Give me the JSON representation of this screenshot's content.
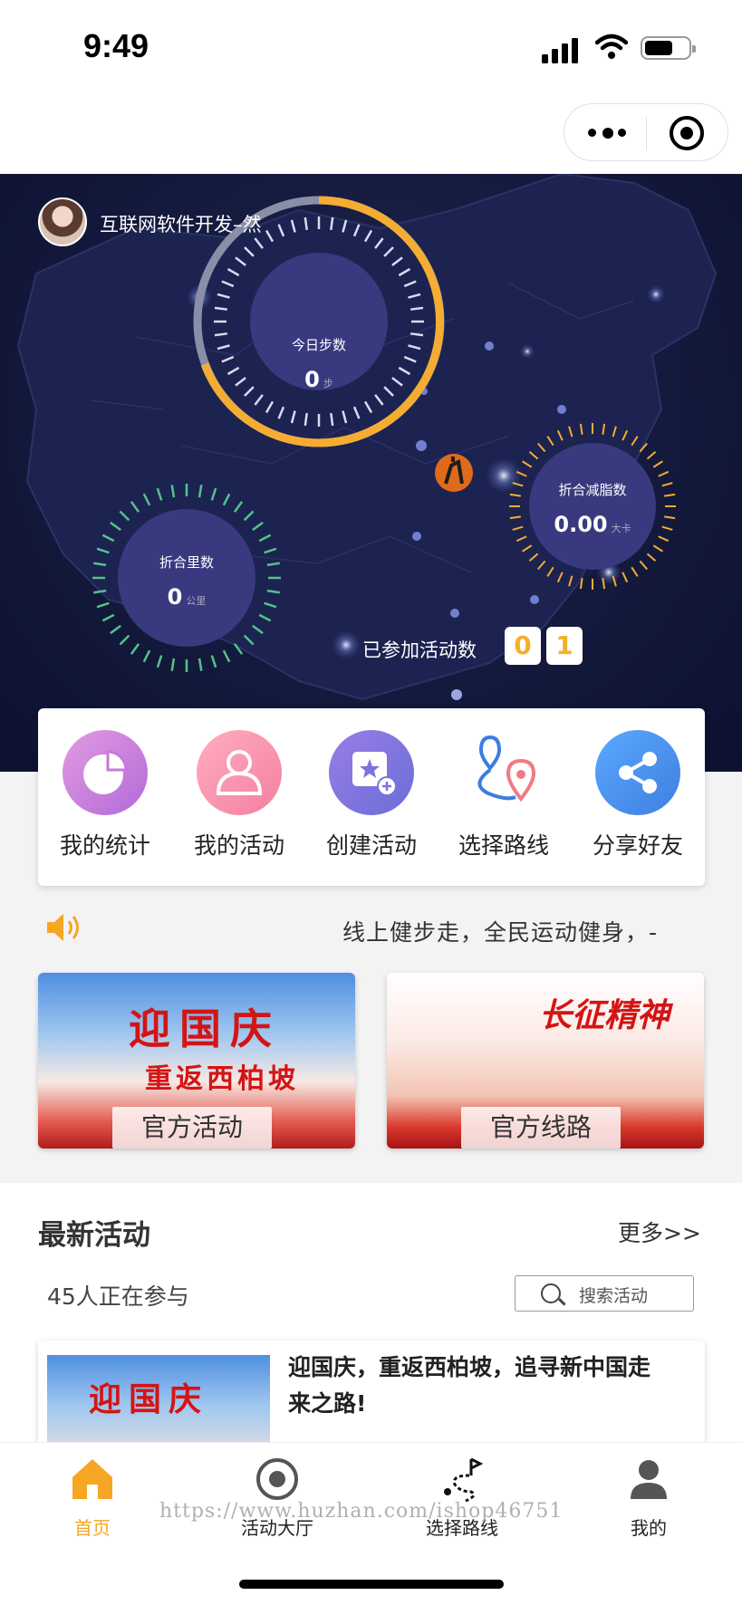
{
  "status_bar": {
    "time": "9:49"
  },
  "user": {
    "name": "互联网软件开发–然"
  },
  "steps_ring": {
    "label": "今日步数",
    "value": "0",
    "unit": "步",
    "progress_fraction": 0.5
  },
  "distance_ring": {
    "label": "折合里数",
    "value": "0",
    "unit": "公里"
  },
  "fat_ring": {
    "label": "折合减脂数",
    "value": "0.00",
    "unit": "大卡"
  },
  "joined": {
    "label": "已参加活动数",
    "digits": [
      "0",
      "1"
    ]
  },
  "quick_menu": {
    "items": [
      {
        "label": "我的统计",
        "icon": "pie-chart-icon"
      },
      {
        "label": "我的活动",
        "icon": "people-icon"
      },
      {
        "label": "创建活动",
        "icon": "create-star-icon"
      },
      {
        "label": "选择路线",
        "icon": "route-pin-icon"
      },
      {
        "label": "分享好友",
        "icon": "share-icon"
      }
    ]
  },
  "notice": {
    "text": "线上健步走，全民运动健身，-"
  },
  "banners": [
    {
      "title": "迎国庆",
      "subtitle": "重返西柏坡",
      "label": "官方活动"
    },
    {
      "title": "长征精神",
      "label": "官方线路"
    }
  ],
  "latest": {
    "title": "最新活动",
    "more": "更多>>",
    "count_text": "45人正在参与",
    "search_placeholder": "搜索活动",
    "card": {
      "image_text": "迎国庆",
      "title": "迎国庆，重返西柏坡，追寻新中国走来之路!"
    }
  },
  "tabbar": {
    "items": [
      {
        "label": "首页",
        "icon": "home-icon",
        "active": true
      },
      {
        "label": "活动大厅",
        "icon": "target-icon",
        "active": false
      },
      {
        "label": "选择路线",
        "icon": "route-flag-icon",
        "active": false
      },
      {
        "label": "我的",
        "icon": "user-icon",
        "active": false
      }
    ]
  },
  "watermark": "https://www.huzhan.com/ishop46751",
  "colors": {
    "accent": "#f5a623",
    "hero_bg": "#141a3d",
    "ring_fill": "#3a3f8a"
  }
}
